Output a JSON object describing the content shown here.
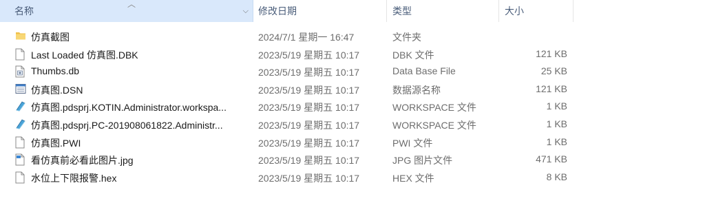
{
  "columns": {
    "name": "名称",
    "date": "修改日期",
    "type": "类型",
    "size": "大小"
  },
  "files": [
    {
      "name": "仿真截图",
      "date": "2024/7/1 星期一 16:47",
      "type": "文件夹",
      "size": "",
      "icon": "folder-icon"
    },
    {
      "name": "Last Loaded 仿真图.DBK",
      "date": "2023/5/19 星期五 10:17",
      "type": "DBK 文件",
      "size": "121 KB",
      "icon": "file-icon"
    },
    {
      "name": "Thumbs.db",
      "date": "2023/5/19 星期五 10:17",
      "type": "Data Base File",
      "size": "25 KB",
      "icon": "database-file-icon"
    },
    {
      "name": "仿真图.DSN",
      "date": "2023/5/19 星期五 10:17",
      "type": "数据源名称",
      "size": "121 KB",
      "icon": "dsn-file-icon"
    },
    {
      "name": "仿真图.pdsprj.KOTIN.Administrator.workspa...",
      "date": "2023/5/19 星期五 10:17",
      "type": "WORKSPACE 文件",
      "size": "1 KB",
      "icon": "workspace-file-icon"
    },
    {
      "name": "仿真图.pdsprj.PC-201908061822.Administr...",
      "date": "2023/5/19 星期五 10:17",
      "type": "WORKSPACE 文件",
      "size": "1 KB",
      "icon": "workspace-file-icon"
    },
    {
      "name": "仿真图.PWI",
      "date": "2023/5/19 星期五 10:17",
      "type": "PWI 文件",
      "size": "1 KB",
      "icon": "file-icon"
    },
    {
      "name": "看仿真前必看此图片.jpg",
      "date": "2023/5/19 星期五 10:17",
      "type": "JPG 图片文件",
      "size": "471 KB",
      "icon": "image-file-icon"
    },
    {
      "name": "水位上下限报警.hex",
      "date": "2023/5/19 星期五 10:17",
      "type": "HEX 文件",
      "size": "8 KB",
      "icon": "file-icon"
    }
  ]
}
